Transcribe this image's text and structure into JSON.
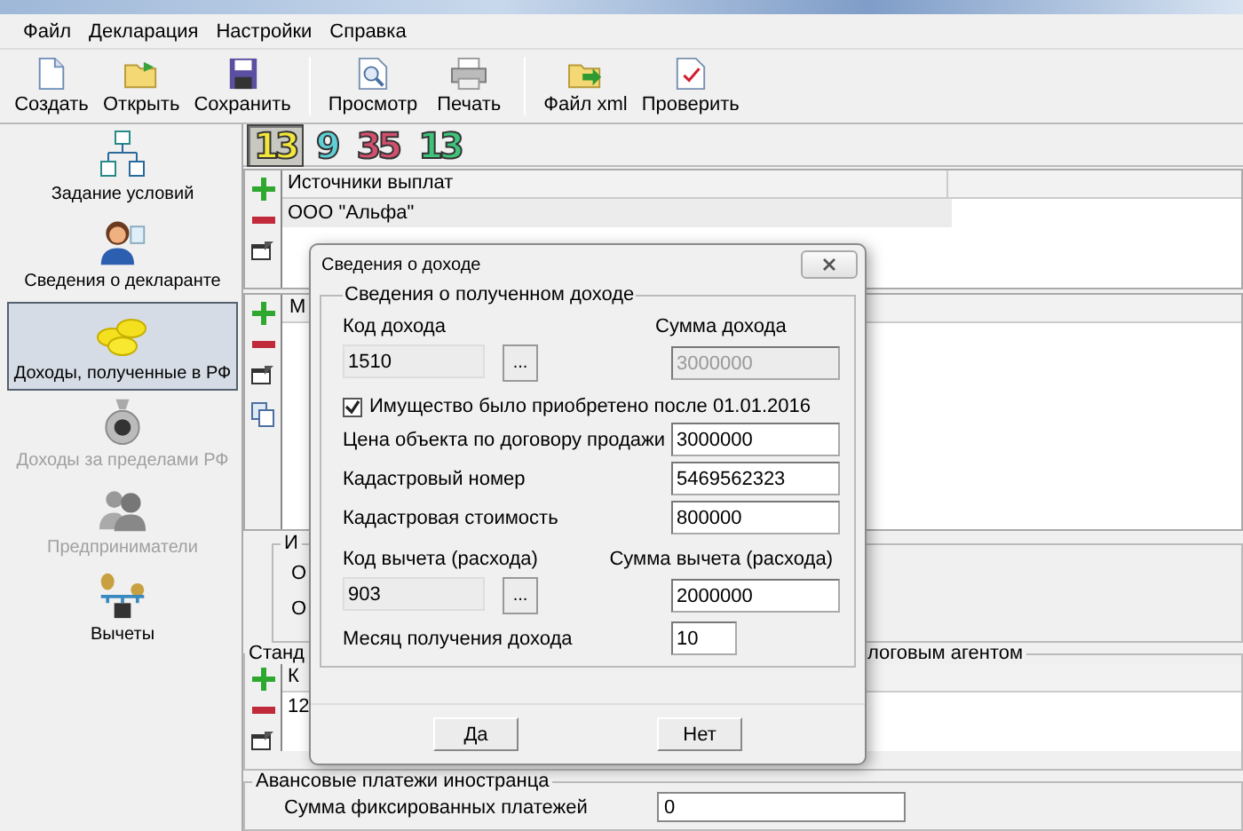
{
  "menu": [
    "Файл",
    "Декларация",
    "Настройки",
    "Справка"
  ],
  "toolbar_groups": [
    [
      "Создать",
      "Открыть",
      "Сохранить"
    ],
    [
      "Просмотр",
      "Печать"
    ],
    [
      "Файл xml",
      "Проверить"
    ]
  ],
  "sidebar": [
    {
      "label": "Задание условий",
      "selected": false,
      "disabled": false
    },
    {
      "label": "Сведения о декларанте",
      "selected": false,
      "disabled": false
    },
    {
      "label": "Доходы, полученные в РФ",
      "selected": true,
      "disabled": false
    },
    {
      "label": "Доходы за пределами РФ",
      "selected": false,
      "disabled": true
    },
    {
      "label": "Предприниматели",
      "selected": false,
      "disabled": true
    },
    {
      "label": "Вычеты",
      "selected": false,
      "disabled": false
    }
  ],
  "rates": [
    {
      "text": "13",
      "color": "#f2e63a",
      "selected": true
    },
    {
      "text": "9",
      "color": "#5fd0d8",
      "selected": false
    },
    {
      "text": "35",
      "color": "#d2506e",
      "selected": false
    },
    {
      "text": "13",
      "color": "#3fc27a",
      "selected": false
    }
  ],
  "payers_table": {
    "header": "Источники выплат",
    "rows": [
      {
        "text": "ООО \"Альфа\"",
        "selected": true
      }
    ]
  },
  "income_table": {
    "header": "М"
  },
  "group_2": {
    "title": "И",
    "rows": [
      "О",
      "О"
    ]
  },
  "group_3": {
    "title_left": "Станд",
    "title_right": "логовым агентом",
    "header": "К",
    "rows": [
      "12"
    ]
  },
  "advance_group": {
    "title": "Авансовые платежи иностранца",
    "label": "Сумма фиксированных платежей",
    "value": "0"
  },
  "dialog": {
    "title": "Сведения о доходе",
    "group_title": "Сведения о полученном доходе",
    "income_code": {
      "label": "Код дохода",
      "value": "1510",
      "button": "..."
    },
    "income_sum": {
      "label": "Сумма дохода",
      "value": "3000000",
      "disabled": true
    },
    "checkbox": {
      "label": "Имущество было приобретено после 01.01.2016",
      "checked": true
    },
    "fields": [
      {
        "label": "Цена объекта по договору продажи",
        "value": "3000000"
      },
      {
        "label": "Кадастровый номер",
        "value": "5469562323"
      },
      {
        "label": "Кадастровая стоимость",
        "value": "800000"
      }
    ],
    "deduction_code": {
      "label": "Код вычета (расхода)",
      "value": "903",
      "button": "..."
    },
    "deduction_sum": {
      "label": "Сумма вычета (расхода)",
      "value": "2000000"
    },
    "month": {
      "label": "Месяц получения дохода",
      "value": "10"
    },
    "buttons": [
      "Да",
      "Нет"
    ]
  }
}
